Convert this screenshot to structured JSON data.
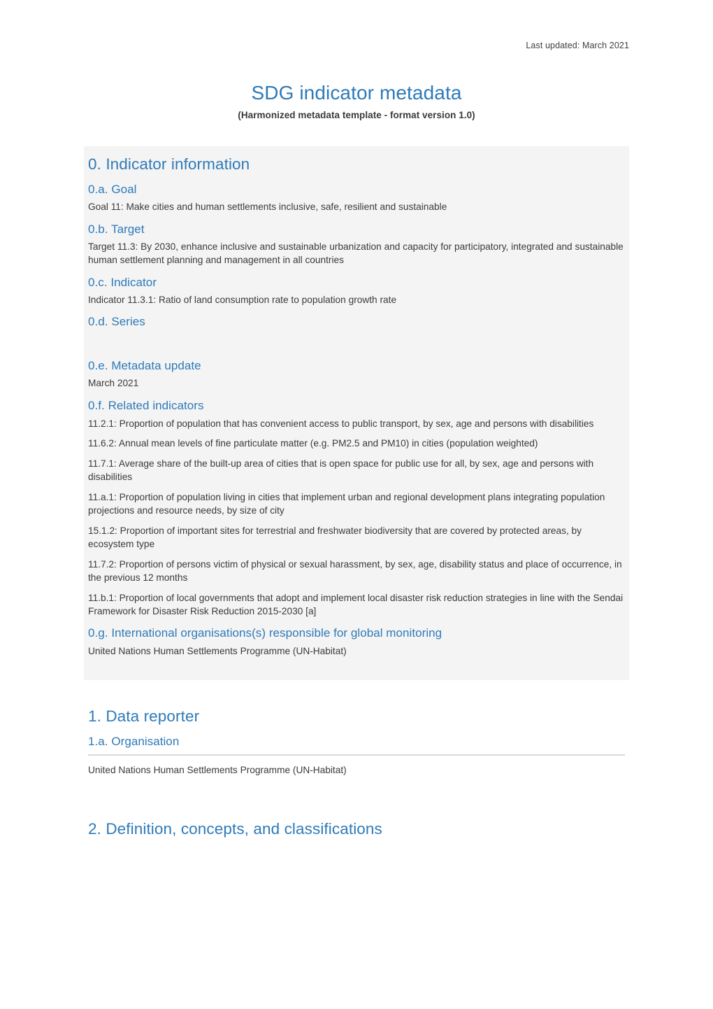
{
  "header": {
    "last_updated": "Last updated: March 2021"
  },
  "title": {
    "main": "SDG indicator metadata",
    "subtitle": "(Harmonized metadata template - format version 1.0)"
  },
  "colors": {
    "heading_blue": "#2e7ab8",
    "body_text": "#3a3a3a",
    "section_background": "#f4f4f4",
    "rule": "#d9d9d9"
  },
  "sections": [
    {
      "id": "section-0",
      "number": "0",
      "heading": "0. Indicator information",
      "shaded": true,
      "blocks": [
        {
          "id": "0a",
          "heading": "0.a. Goal",
          "paragraphs": [
            "Goal 11: Make cities and human settlements inclusive, safe, resilient and sustainable"
          ]
        },
        {
          "id": "0b",
          "heading": "0.b. Target",
          "paragraphs": [
            "Target 11.3: By 2030, enhance inclusive and sustainable urbanization and capacity for participatory, integrated and sustainable human settlement planning and management in all countries"
          ]
        },
        {
          "id": "0c",
          "heading": "0.c. Indicator",
          "paragraphs": [
            "Indicator 11.3.1: Ratio of land consumption rate to population growth rate"
          ]
        },
        {
          "id": "0d",
          "heading": "0.d. Series",
          "paragraphs": []
        },
        {
          "id": "0e",
          "heading": "0.e. Metadata update",
          "paragraphs": [
            "March 2021"
          ]
        },
        {
          "id": "0f",
          "heading": "0.f. Related indicators",
          "paragraphs": [
            "11.2.1: Proportion of population that has convenient access to public transport, by sex, age and persons with disabilities",
            "11.6.2: Annual mean levels of fine particulate matter (e.g. PM2.5 and PM10) in cities (population weighted)",
            "11.7.1: Average share of the built-up area of cities that is open space for public use for all, by sex, age and persons with disabilities",
            "11.a.1: Proportion of population living in cities that implement urban and regional development plans integrating population projections and resource needs, by size of city",
            "15.1.2: Proportion of important sites for terrestrial and freshwater biodiversity that are covered by protected areas, by ecosystem type",
            "11.7.2: Proportion of persons victim of physical or sexual harassment, by sex, age, disability status and place of occurrence, in the previous 12 months",
            "11.b.1: Proportion of local governments that adopt and implement local disaster risk reduction strategies in line with the Sendai Framework for Disaster Risk Reduction 2015-2030 [a]"
          ]
        },
        {
          "id": "0g",
          "heading": "0.g. International organisations(s) responsible for global monitoring",
          "paragraphs": [
            "United Nations Human Settlements Programme (UN-Habitat)"
          ]
        }
      ]
    },
    {
      "id": "section-1",
      "number": "1",
      "heading": "1. Data reporter",
      "shaded": false,
      "blocks": [
        {
          "id": "1a",
          "heading": "1.a. Organisation",
          "rule_after_heading": true,
          "paragraphs": [
            "United Nations Human Settlements Programme (UN-Habitat)"
          ]
        }
      ]
    },
    {
      "id": "section-2",
      "number": "2",
      "heading": "2. Definition, concepts, and classifications",
      "shaded": false,
      "blocks": []
    }
  ],
  "labels": {
    "goal_heading": "0.a. Goal",
    "target_heading": "0.b. Target",
    "indicator_heading": "0.c. Indicator",
    "series_heading": "0.d. Series",
    "metadata_update_heading": "0.e. Metadata update",
    "related_indicators_heading": "0.f. Related indicators",
    "intl_orgs_heading": "0.g. International organisations(s) responsible for global monitoring",
    "organisation_heading": "1.a. Organisation"
  }
}
